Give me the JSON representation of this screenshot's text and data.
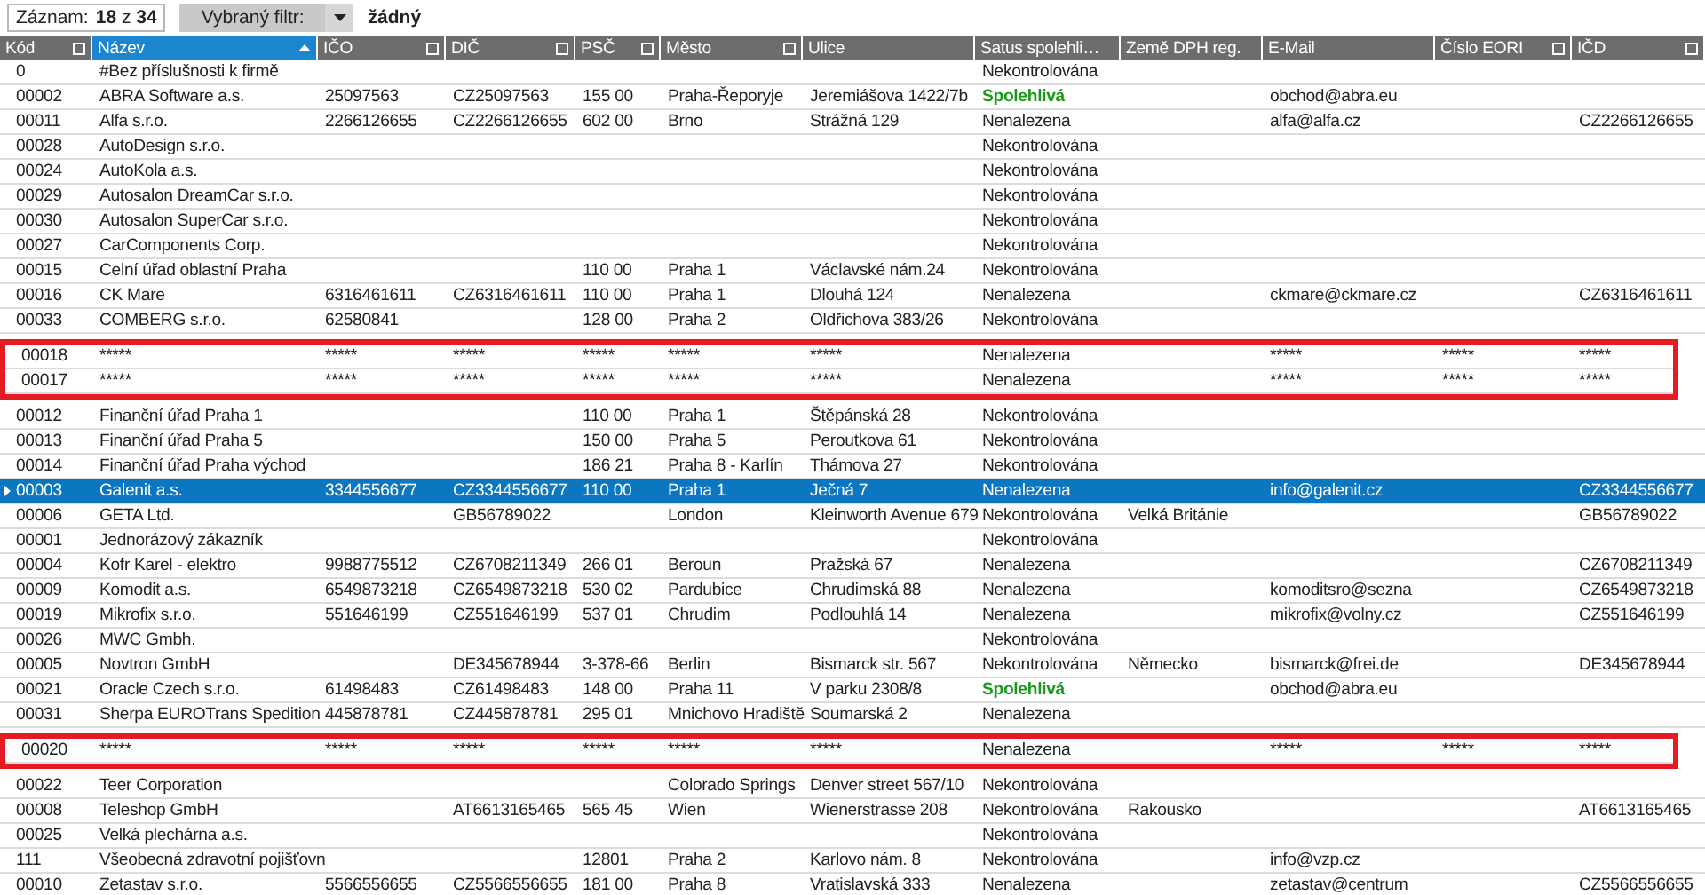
{
  "toolbar": {
    "record_label": "Záznam:",
    "record_value": "**18** z **34**",
    "filter_button": "Vybraný filtr:",
    "filter_value": "žádný"
  },
  "table": {
    "columns": [
      {
        "label": "Kód",
        "selected": false,
        "sorted_ascending": false,
        "filter": true
      },
      {
        "label": "Název",
        "selected": true,
        "sorted_ascending": true,
        "filter": false
      },
      {
        "label": "IČO",
        "selected": false,
        "sorted_ascending": false,
        "filter": true
      },
      {
        "label": "DIČ",
        "selected": false,
        "sorted_ascending": false,
        "filter": true
      },
      {
        "label": "PSČ",
        "selected": false,
        "sorted_ascending": false,
        "filter": true
      },
      {
        "label": "Město",
        "selected": false,
        "sorted_ascending": false,
        "filter": true
      },
      {
        "label": "Ulice",
        "selected": false,
        "sorted_ascending": false,
        "filter": false
      },
      {
        "label": "Satus spolehli…",
        "selected": false,
        "sorted_ascending": false,
        "filter": false
      },
      {
        "label": "Země DPH reg.",
        "selected": false,
        "sorted_ascending": false,
        "filter": false
      },
      {
        "label": "E-Mail",
        "selected": false,
        "sorted_ascending": false,
        "filter": false
      },
      {
        "label": "Číslo EORI",
        "selected": false,
        "sorted_ascending": false,
        "filter": true
      },
      {
        "label": "IČD",
        "selected": false,
        "sorted_ascending": false,
        "filter": true
      }
    ],
    "rows": [
      {
        "kind": "record",
        "selected": false,
        "reliable": false,
        "cells": [
          "0",
          "#Bez příslušnosti k firmě",
          null,
          null,
          null,
          null,
          null,
          "Nekontrolována",
          null,
          null,
          null,
          null
        ]
      },
      {
        "kind": "record",
        "selected": false,
        "reliable": true,
        "cells": [
          "00002",
          "ABRA Software a.s.",
          "25097563",
          "CZ25097563",
          "155 00",
          "Praha-Řeporyje",
          "Jeremiášova 1422/7b",
          "Spolehlivá",
          null,
          "obchod@abra.eu",
          null,
          null
        ]
      },
      {
        "kind": "record",
        "selected": false,
        "reliable": false,
        "cells": [
          "00011",
          "Alfa s.r.o.",
          "2266126655",
          "CZ2266126655",
          "602 00",
          "Brno",
          "Strážná 129",
          "Nenalezena",
          null,
          "alfa@alfa.cz",
          null,
          "CZ2266126655"
        ]
      },
      {
        "kind": "record",
        "selected": false,
        "reliable": false,
        "cells": [
          "00028",
          "AutoDesign s.r.o.",
          null,
          null,
          null,
          null,
          null,
          "Nekontrolována",
          null,
          null,
          null,
          null
        ]
      },
      {
        "kind": "record",
        "selected": false,
        "reliable": false,
        "cells": [
          "00024",
          "AutoKola a.s.",
          null,
          null,
          null,
          null,
          null,
          "Nekontrolována",
          null,
          null,
          null,
          null
        ]
      },
      {
        "kind": "record",
        "selected": false,
        "reliable": false,
        "cells": [
          "00029",
          "Autosalon DreamCar s.r.o.",
          null,
          null,
          null,
          null,
          null,
          "Nekontrolována",
          null,
          null,
          null,
          null
        ]
      },
      {
        "kind": "record",
        "selected": false,
        "reliable": false,
        "cells": [
          "00030",
          "Autosalon SuperCar s.r.o.",
          null,
          null,
          null,
          null,
          null,
          "Nekontrolována",
          null,
          null,
          null,
          null
        ]
      },
      {
        "kind": "record",
        "selected": false,
        "reliable": false,
        "cells": [
          "00027",
          "CarComponents Corp.",
          null,
          null,
          null,
          null,
          null,
          "Nekontrolována",
          null,
          null,
          null,
          null
        ]
      },
      {
        "kind": "record",
        "selected": false,
        "reliable": false,
        "cells": [
          "00015",
          "Celní úřad oblastní Praha",
          null,
          null,
          "110 00",
          "Praha 1",
          "Václavské nám.24",
          "Nekontrolována",
          null,
          null,
          null,
          null
        ]
      },
      {
        "kind": "record",
        "selected": false,
        "reliable": false,
        "cells": [
          "00016",
          "CK Mare",
          "6316461611",
          "CZ6316461611",
          "110 00",
          "Praha 1",
          "Dlouhá 124",
          "Nenalezena",
          null,
          "ckmare@ckmare.cz",
          null,
          "CZ6316461611"
        ]
      },
      {
        "kind": "record",
        "selected": false,
        "reliable": false,
        "cells": [
          "00033",
          "COMBERG s.r.o.",
          "62580841",
          null,
          "128 00",
          "Praha 2",
          "Oldřichova 383/26",
          "Nekontrolována",
          null,
          null,
          null,
          null
        ]
      },
      {
        "kind": "callout",
        "rows": [
          {
            "kind": "record",
            "selected": false,
            "reliable": false,
            "cells": [
              "00018",
              "*****",
              "*****",
              "*****",
              "*****",
              "*****",
              "*****",
              "Nenalezena",
              null,
              "*****",
              "*****",
              "*****"
            ]
          },
          {
            "kind": "record",
            "selected": false,
            "reliable": false,
            "cells": [
              "00017",
              "*****",
              "*****",
              "*****",
              "*****",
              "*****",
              "*****",
              "Nenalezena",
              null,
              "*****",
              "*****",
              "*****"
            ]
          }
        ]
      },
      {
        "kind": "record",
        "selected": false,
        "reliable": false,
        "cells": [
          "00012",
          "Finanční úřad Praha 1",
          null,
          null,
          "110 00",
          "Praha 1",
          "Štěpánská 28",
          "Nekontrolována",
          null,
          null,
          null,
          null
        ]
      },
      {
        "kind": "record",
        "selected": false,
        "reliable": false,
        "cells": [
          "00013",
          "Finanční úřad Praha 5",
          null,
          null,
          "150 00",
          "Praha 5",
          "Peroutkova 61",
          "Nekontrolována",
          null,
          null,
          null,
          null
        ]
      },
      {
        "kind": "record",
        "selected": false,
        "reliable": false,
        "cells": [
          "00014",
          "Finanční úřad Praha východ",
          null,
          null,
          "186 21",
          "Praha 8 - Karlín",
          "Thámova 27",
          "Nekontrolována",
          null,
          null,
          null,
          null
        ]
      },
      {
        "kind": "record",
        "selected": true,
        "reliable": false,
        "cells": [
          "00003",
          "Galenit a.s.",
          "3344556677",
          "CZ3344556677",
          "110 00",
          "Praha 1",
          "Ječná 7",
          "Nenalezena",
          null,
          "info@galenit.cz",
          null,
          "CZ3344556677"
        ]
      },
      {
        "kind": "record",
        "selected": false,
        "reliable": false,
        "cells": [
          "00006",
          "GETA Ltd.",
          null,
          "GB56789022",
          null,
          "London",
          "Kleinworth Avenue 679",
          "Nekontrolována",
          "Velká Británie",
          null,
          null,
          "GB56789022"
        ]
      },
      {
        "kind": "record",
        "selected": false,
        "reliable": false,
        "cells": [
          "00001",
          "Jednorázový zákazník",
          null,
          null,
          null,
          null,
          null,
          "Nekontrolována",
          null,
          null,
          null,
          null
        ]
      },
      {
        "kind": "record",
        "selected": false,
        "reliable": false,
        "cells": [
          "00004",
          "Kofr Karel - elektro",
          "9988775512",
          "CZ6708211349",
          "266 01",
          "Beroun",
          "Pražská 67",
          "Nenalezena",
          null,
          null,
          null,
          "CZ6708211349"
        ]
      },
      {
        "kind": "record",
        "selected": false,
        "reliable": false,
        "cells": [
          "00009",
          "Komodit a.s.",
          "6549873218",
          "CZ6549873218",
          "530 02",
          "Pardubice",
          "Chrudimská 88",
          "Nenalezena",
          null,
          "komoditsro@sezna",
          null,
          "CZ6549873218"
        ]
      },
      {
        "kind": "record",
        "selected": false,
        "reliable": false,
        "cells": [
          "00019",
          "Mikrofix s.r.o.",
          "551646199",
          "CZ551646199",
          "537 01",
          "Chrudim",
          "Podlouhlá 14",
          "Nenalezena",
          null,
          "mikrofix@volny.cz",
          null,
          "CZ551646199"
        ]
      },
      {
        "kind": "record",
        "selected": false,
        "reliable": false,
        "cells": [
          "00026",
          "MWC Gmbh.",
          null,
          null,
          null,
          null,
          null,
          "Nekontrolována",
          null,
          null,
          null,
          null
        ]
      },
      {
        "kind": "record",
        "selected": false,
        "reliable": false,
        "cells": [
          "00005",
          "Novtron GmbH",
          null,
          "DE345678944",
          "3-378-66",
          "Berlin",
          "Bismarck str. 567",
          "Nekontrolována",
          "Německo",
          "bismarck@frei.de",
          null,
          "DE345678944"
        ]
      },
      {
        "kind": "record",
        "selected": false,
        "reliable": true,
        "cells": [
          "00021",
          "Oracle Czech s.r.o.",
          "61498483",
          "CZ61498483",
          "148 00",
          "Praha 11",
          "V parku 2308/8",
          "Spolehlivá",
          null,
          "obchod@abra.eu",
          null,
          null
        ]
      },
      {
        "kind": "record",
        "selected": false,
        "reliable": false,
        "cells": [
          "00031",
          "Sherpa EUROTrans Spedition",
          "445878781",
          "CZ445878781",
          "295 01",
          "Mnichovo Hradiště",
          "Soumarská 2",
          "Nenalezena",
          null,
          null,
          null,
          null
        ]
      },
      {
        "kind": "callout",
        "rows": [
          {
            "kind": "record",
            "selected": false,
            "reliable": false,
            "cells": [
              "00020",
              "*****",
              "*****",
              "*****",
              "*****",
              "*****",
              "*****",
              "Nenalezena",
              null,
              "*****",
              "*****",
              "*****"
            ]
          }
        ]
      },
      {
        "kind": "record",
        "selected": false,
        "reliable": false,
        "cells": [
          "00022",
          "Teer Corporation",
          null,
          null,
          null,
          "Colorado Springs",
          "Denver street 567/10",
          "Nekontrolována",
          null,
          null,
          null,
          null
        ]
      },
      {
        "kind": "record",
        "selected": false,
        "reliable": false,
        "cells": [
          "00008",
          "Teleshop GmbH",
          null,
          "AT6613165465",
          "565 45",
          "Wien",
          "Wienerstrasse 208",
          "Nekontrolována",
          "Rakousko",
          null,
          null,
          "AT6613165465"
        ]
      },
      {
        "kind": "record",
        "selected": false,
        "reliable": false,
        "cells": [
          "00025",
          "Velká plechárna a.s.",
          null,
          null,
          null,
          null,
          null,
          "Nekontrolována",
          null,
          null,
          null,
          null
        ]
      },
      {
        "kind": "record",
        "selected": false,
        "reliable": false,
        "cells": [
          "111",
          "Všeobecná zdravotní pojišťovn",
          null,
          null,
          "12801",
          "Praha 2",
          "Karlovo nám. 8",
          "Nekontrolována",
          null,
          "info@vzp.cz",
          null,
          null
        ]
      },
      {
        "kind": "record",
        "selected": false,
        "reliable": false,
        "cells": [
          "00010",
          "Zetastav s.r.o.",
          "5566556655",
          "CZ5566556655",
          "181 00",
          "Praha 8",
          "Vratislavská 333",
          "Nenalezena",
          null,
          "zetastav@centrum",
          null,
          "CZ5566556655"
        ]
      }
    ]
  }
}
